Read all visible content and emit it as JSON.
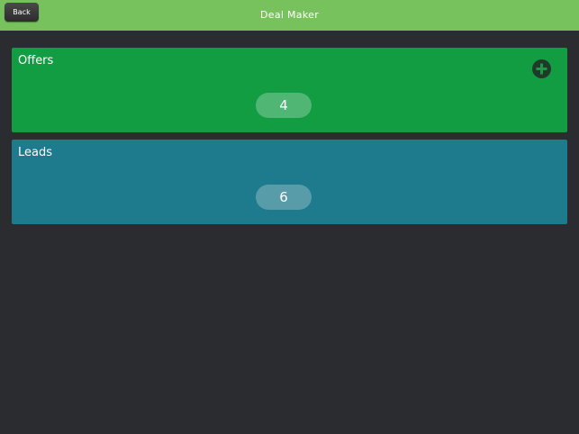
{
  "header": {
    "back_label": "Back",
    "title": "Deal Maker"
  },
  "cards": [
    {
      "label": "Offers",
      "count": "4",
      "color": "#129d43"
    },
    {
      "label": "Leads",
      "count": "6",
      "color": "#1e7a8d"
    }
  ],
  "icons": {
    "add": "plus-circle-icon"
  },
  "colors": {
    "navbar": "#77c25d",
    "background": "#2b2c30"
  }
}
